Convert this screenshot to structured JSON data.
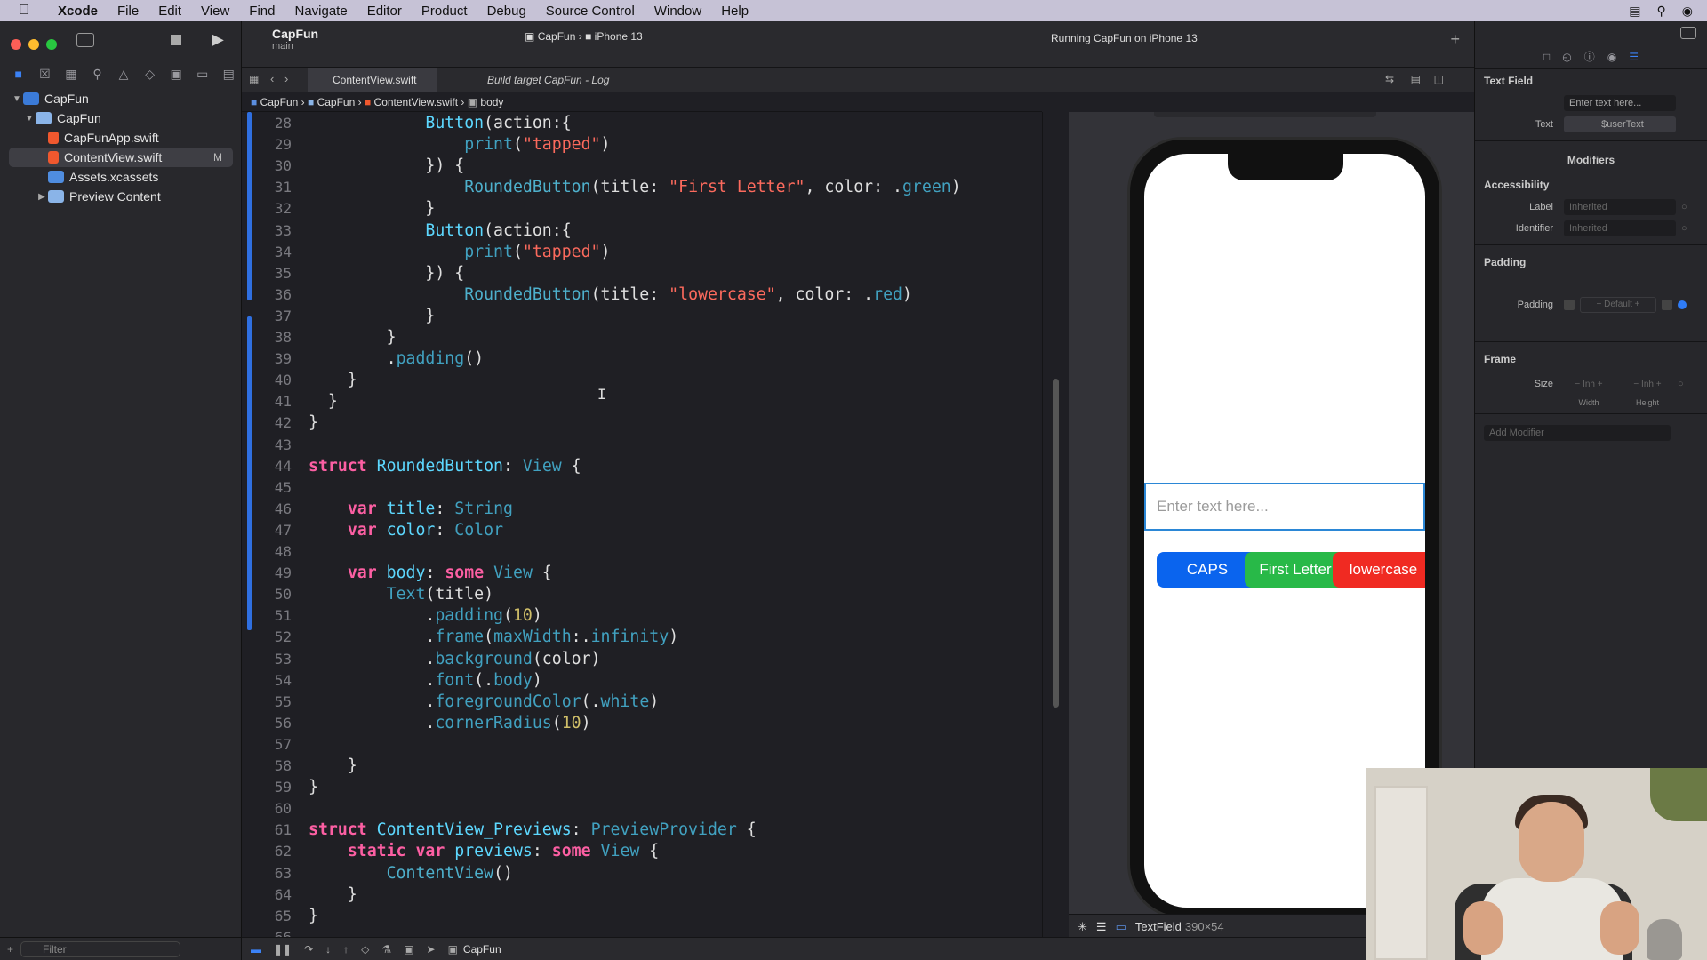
{
  "menubar": {
    "app": "Xcode",
    "items": [
      "File",
      "Edit",
      "View",
      "Find",
      "Navigate",
      "Editor",
      "Product",
      "Debug",
      "Source Control",
      "Window",
      "Help"
    ]
  },
  "toolbar": {
    "scheme_name": "CapFun",
    "branch": "main",
    "target_scheme": "CapFun",
    "target_device": "iPhone 13",
    "run_status": "Running CapFun on iPhone 13"
  },
  "navigator": {
    "items": [
      {
        "label": "CapFun",
        "level": 0
      },
      {
        "label": "CapFun",
        "level": 1
      },
      {
        "label": "CapFunApp.swift",
        "level": 2
      },
      {
        "label": "ContentView.swift",
        "level": 2,
        "badge": "M"
      },
      {
        "label": "Assets.xcassets",
        "level": 2
      },
      {
        "label": "Preview Content",
        "level": 2
      }
    ],
    "filter_placeholder": "Filter"
  },
  "tabs": [
    {
      "label": "ContentView.swift"
    },
    {
      "label": "Build target CapFun - Log"
    }
  ],
  "jumpbar": [
    "CapFun",
    "CapFun",
    "ContentView.swift",
    "body"
  ],
  "code": {
    "lines": [
      {
        "n": "28",
        "html": "            <span class='typ'>Button</span>(action:{"
      },
      {
        "n": "29",
        "html": "                <span class='fn'>print</span>(<span class='str'>\"tapped\"</span>)"
      },
      {
        "n": "30",
        "html": "            }) {"
      },
      {
        "n": "31",
        "html": "                <span class='usr'>RoundedButton</span>(title: <span class='str'>\"First Letter\"</span>, color: .<span class='fn'>green</span>)"
      },
      {
        "n": "32",
        "html": "            }"
      },
      {
        "n": "33",
        "html": "            <span class='typ'>Button</span>(action:{"
      },
      {
        "n": "34",
        "html": "                <span class='fn'>print</span>(<span class='str'>\"tapped\"</span>)"
      },
      {
        "n": "35",
        "html": "            }) {"
      },
      {
        "n": "36",
        "html": "                <span class='usr'>RoundedButton</span>(title: <span class='str'>\"lowercase\"</span>, color: .<span class='fn'>red</span>)"
      },
      {
        "n": "37",
        "html": "            }"
      },
      {
        "n": "38",
        "html": "        }"
      },
      {
        "n": "39",
        "html": "        .<span class='fn'>padding</span>()"
      },
      {
        "n": "40",
        "html": "    }"
      },
      {
        "n": "41",
        "html": "  }"
      },
      {
        "n": "42",
        "html": "}"
      },
      {
        "n": "43",
        "html": ""
      },
      {
        "n": "44",
        "html": "<span class='kw'>struct</span> <span class='typ'>RoundedButton</span>: <span class='fn'>View</span> {"
      },
      {
        "n": "45",
        "html": ""
      },
      {
        "n": "46",
        "html": "    <span class='kw'>var</span> <span class='typ'>title</span>: <span class='fn'>String</span>"
      },
      {
        "n": "47",
        "html": "    <span class='kw'>var</span> <span class='typ'>color</span>: <span class='fn'>Color</span>"
      },
      {
        "n": "48",
        "html": ""
      },
      {
        "n": "49",
        "html": "    <span class='kw'>var</span> <span class='typ'>body</span>: <span class='kw'>some</span> <span class='fn'>View</span> {"
      },
      {
        "n": "50",
        "html": "        <span class='fn'>Text</span>(title)"
      },
      {
        "n": "51",
        "html": "            .<span class='fn'>padding</span>(<span class='num'>10</span>)"
      },
      {
        "n": "52",
        "html": "            .<span class='fn'>frame</span>(<span class='fn'>maxWidth</span>:.<span class='fn'>infinity</span>)"
      },
      {
        "n": "53",
        "html": "            .<span class='fn'>background</span>(color)"
      },
      {
        "n": "54",
        "html": "            .<span class='fn'>font</span>(.<span class='fn'>body</span>)"
      },
      {
        "n": "55",
        "html": "            .<span class='fn'>foregroundColor</span>(.<span class='fn'>white</span>)"
      },
      {
        "n": "56",
        "html": "            .<span class='fn'>cornerRadius</span>(<span class='num'>10</span>)"
      },
      {
        "n": "57",
        "html": ""
      },
      {
        "n": "58",
        "html": "    }"
      },
      {
        "n": "59",
        "html": "}"
      },
      {
        "n": "60",
        "html": ""
      },
      {
        "n": "61",
        "html": "<span class='kw'>struct</span> <span class='typ'>ContentView_Previews</span>: <span class='fn'>PreviewProvider</span> {"
      },
      {
        "n": "62",
        "html": "    <span class='kw'>static var</span> <span class='typ'>previews</span>: <span class='kw'>some</span> <span class='fn'>View</span> {"
      },
      {
        "n": "63",
        "html": "        <span class='usr'>ContentView</span>()"
      },
      {
        "n": "64",
        "html": "    }"
      },
      {
        "n": "65",
        "html": "}"
      },
      {
        "n": "66",
        "html": ""
      }
    ]
  },
  "debug_bar": {
    "target": "CapFun"
  },
  "preview": {
    "textfield_placeholder": "Enter text here...",
    "buttons": [
      {
        "label": "CAPS",
        "color": "#0a64ee"
      },
      {
        "label": "First Letter",
        "color": "#28b948"
      },
      {
        "label": "lowercase",
        "color": "#f02a22"
      }
    ],
    "status_label": "TextField",
    "status_size": "390×54"
  },
  "inspector": {
    "section_title": "Text Field",
    "placeholder_field": "Enter text here...",
    "text_label": "Text",
    "text_value": "$userText",
    "modifiers_title": "Modifiers",
    "accessibility_title": "Accessibility",
    "label_label": "Label",
    "label_value": "Inherited",
    "identifier_label": "Identifier",
    "identifier_value": "Inherited",
    "padding_title": "Padding",
    "padding_label": "Padding",
    "padding_value": "Default",
    "frame_title": "Frame",
    "size_label": "Size",
    "width_value": "Inh",
    "height_value": "Inh",
    "width_label": "Width",
    "height_label": "Height",
    "add_modifier": "Add Modifier"
  }
}
